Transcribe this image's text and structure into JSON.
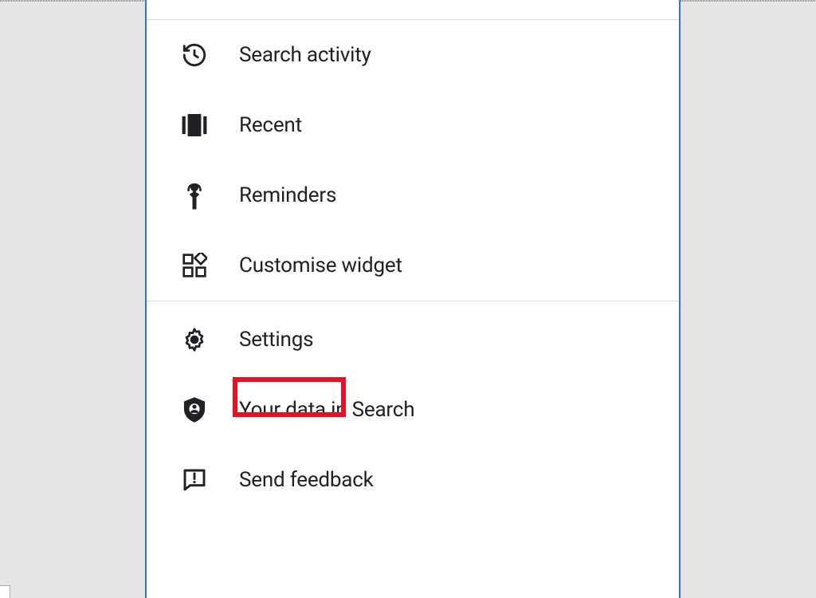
{
  "menu": {
    "group1": [
      {
        "label": "Search activity",
        "icon": "history-icon"
      },
      {
        "label": "Recent",
        "icon": "recent-icon"
      },
      {
        "label": "Reminders",
        "icon": "reminders-icon"
      },
      {
        "label": "Customise widget",
        "icon": "widgets-icon"
      }
    ],
    "group2": [
      {
        "label": "Settings",
        "icon": "gear-icon",
        "highlighted": true
      },
      {
        "label": "Your data in Search",
        "icon": "privacy-shield-icon"
      },
      {
        "label": "Send feedback",
        "icon": "feedback-icon"
      }
    ]
  },
  "highlight_color": "#e81123",
  "panel_border_color": "#3a6dd6"
}
